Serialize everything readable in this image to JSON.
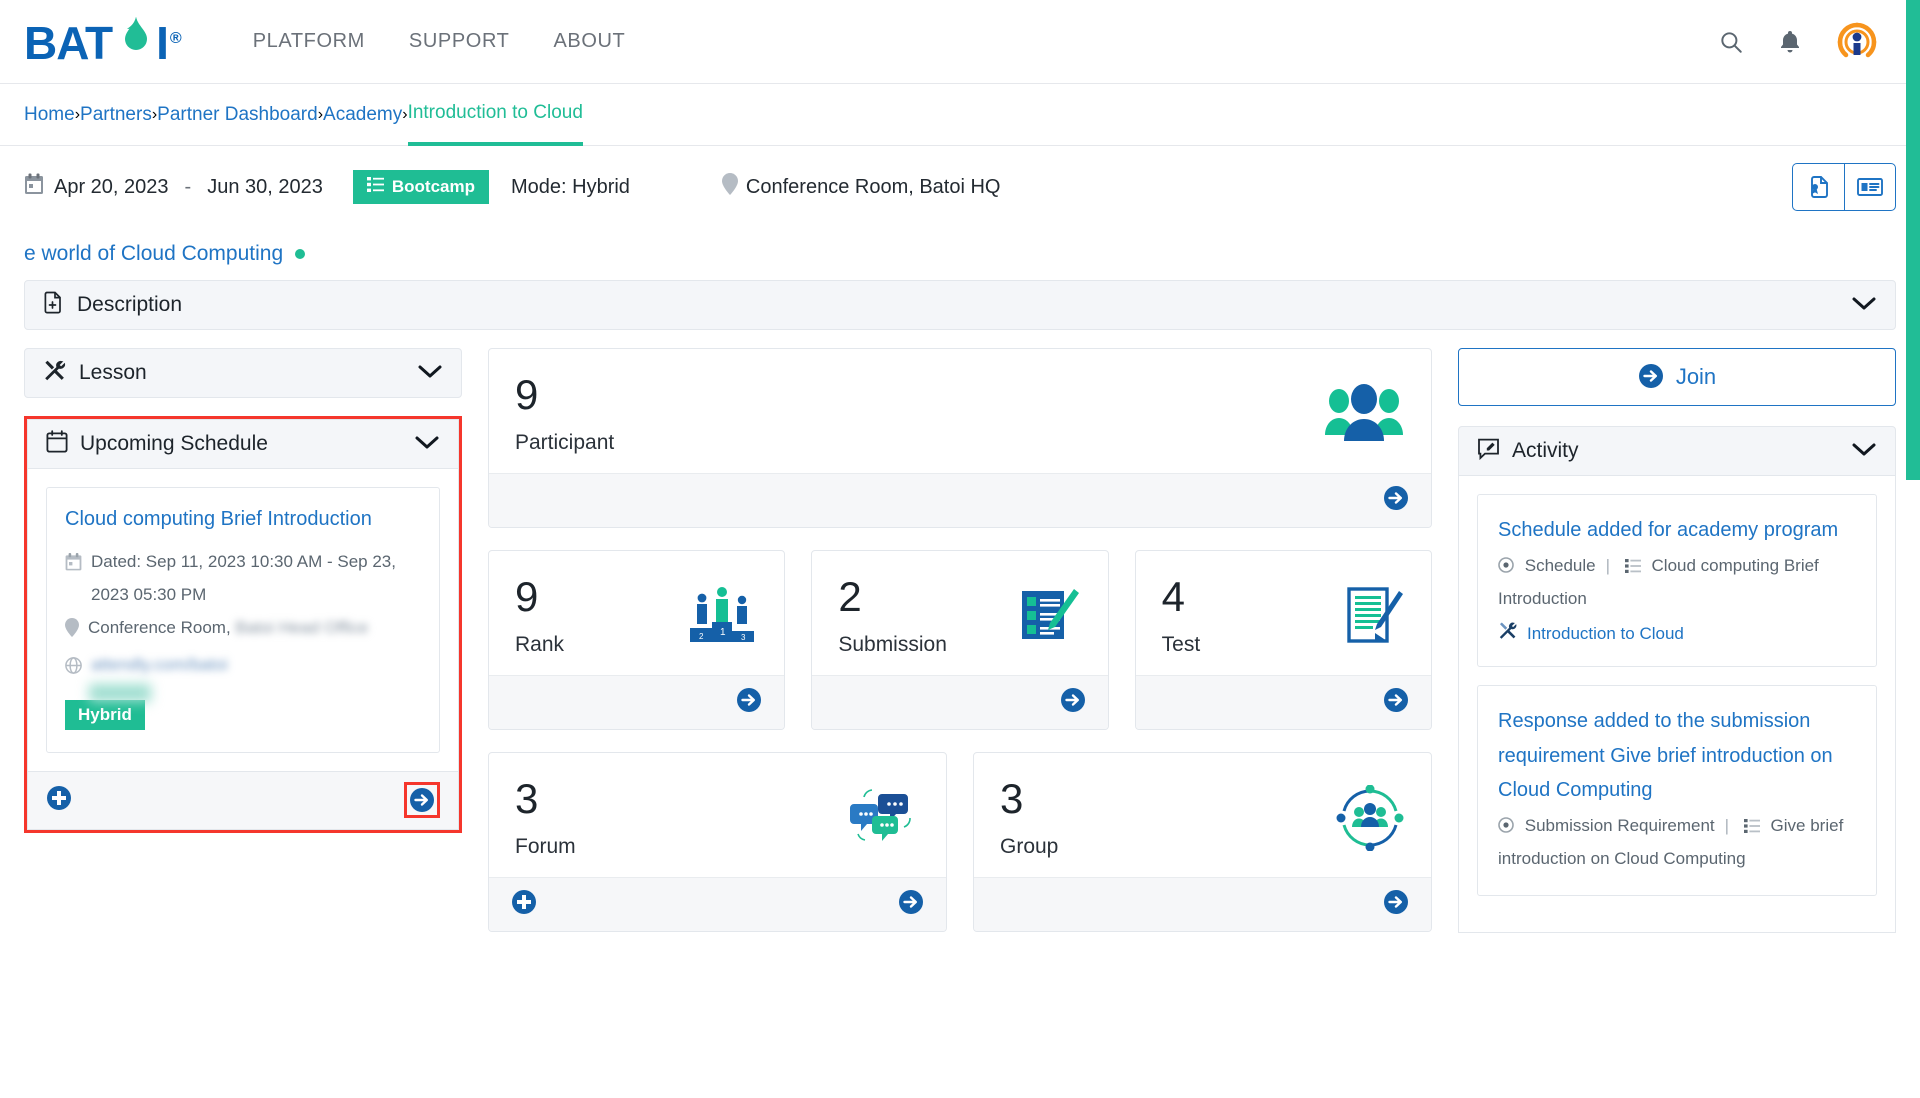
{
  "brand": {
    "name": "BATOI",
    "registered": "®"
  },
  "nav": {
    "items": [
      {
        "label": "PLATFORM"
      },
      {
        "label": "SUPPORT"
      },
      {
        "label": "ABOUT"
      }
    ],
    "search_icon": "search-icon",
    "bell_icon": "bell-icon",
    "avatar_icon": "user-avatar"
  },
  "breadcrumb": [
    {
      "label": "Home",
      "active": false
    },
    {
      "label": "Partners",
      "active": false
    },
    {
      "label": "Partner Dashboard",
      "active": false
    },
    {
      "label": "Academy",
      "active": false
    },
    {
      "label": "Introduction to Cloud",
      "active": true
    }
  ],
  "meta": {
    "start_date": "Apr 20, 2023",
    "dash": "-",
    "end_date": "Jun 30, 2023",
    "type_badge": "Bootcamp",
    "mode": "Mode: Hybrid",
    "location": "Conference Room, Batoi HQ",
    "action_certificate": "certificate-icon",
    "action_cards": "news-card-icon"
  },
  "subtitle": {
    "text": "e world of Cloud Computing"
  },
  "panels": {
    "description": {
      "title": "Description",
      "icon": "document-add-icon"
    },
    "lesson": {
      "title": "Lesson",
      "icon": "tools-icon"
    },
    "upcoming": {
      "title": "Upcoming Schedule",
      "icon": "calendar-icon"
    },
    "activity": {
      "title": "Activity",
      "icon": "comment-edit-icon"
    }
  },
  "schedule_card": {
    "title": "Cloud computing Brief Introduction",
    "dated": "Dated: Sep 11, 2023 10:30 AM - Sep 23, 2023 05:30 PM",
    "location_prefix": "Conference Room,",
    "location_redacted": "Batoi Head Office",
    "url_redacted": "attendly.com/batoi",
    "tag": "Hybrid",
    "add_button": "add-icon",
    "go_button": "arrow-right-icon"
  },
  "stats": [
    {
      "value": "9",
      "label": "Participant",
      "art": "participants-art",
      "has_add": false,
      "has_go": true,
      "span": "full"
    },
    {
      "value": "9",
      "label": "Rank",
      "art": "podium-art",
      "has_add": false,
      "has_go": true,
      "span": "third"
    },
    {
      "value": "2",
      "label": "Submission",
      "art": "submission-art",
      "has_add": false,
      "has_go": true,
      "span": "third"
    },
    {
      "value": "4",
      "label": "Test",
      "art": "test-art",
      "has_add": false,
      "has_go": true,
      "span": "third"
    },
    {
      "value": "3",
      "label": "Forum",
      "art": "forum-art",
      "has_add": true,
      "has_go": true,
      "span": "half"
    },
    {
      "value": "3",
      "label": "Group",
      "art": "group-art",
      "has_add": false,
      "has_go": true,
      "span": "half"
    }
  ],
  "join": {
    "label": "Join",
    "icon": "arrow-right-circle-icon"
  },
  "activities": [
    {
      "title": "Schedule added for academy program",
      "type": "Schedule",
      "pipe": "|",
      "subject": "Cloud computing Brief Introduction",
      "link": "Introduction to Cloud"
    },
    {
      "title": "Response added to the submission requirement Give brief introduction on Cloud Computing",
      "type": "Submission Requirement",
      "pipe": "|",
      "subject": "Give brief introduction on Cloud Computing",
      "link": ""
    }
  ],
  "colors": {
    "brand_blue": "#0b63b5",
    "brand_green": "#21bd96",
    "link_blue": "#1f74c4",
    "highlight_red": "#f5362c",
    "panel_bg": "#f4f6f9"
  }
}
